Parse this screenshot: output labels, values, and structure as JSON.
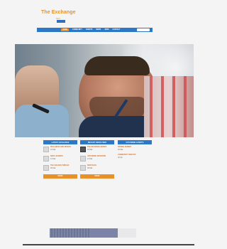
{
  "header": {
    "title": "The Exchange",
    "subtitle": "NPC"
  },
  "nav": {
    "items": [
      "HOME",
      "COMMUNITY",
      "EVENTS",
      "NEWS",
      "JOBS",
      "CONTACT"
    ],
    "active_index": 0
  },
  "columns": {
    "latest_exchange": {
      "header": "LATEST EXCHANGE",
      "items": [
        {
          "title": "WELLNESS AND DESIGN",
          "date": "19 Mar"
        },
        {
          "title": "NEW LEADERS",
          "date": "13 Mar"
        },
        {
          "title": "THE GOLDEN THREAD",
          "date": "06 Mar"
        }
      ],
      "button": "MORE"
    },
    "recent_news": {
      "header": "RECENT NEWS FEED",
      "items": [
        {
          "title": "THE NETWORK SERIES",
          "date": "18 Mar"
        },
        {
          "title": "UPCOMING SESSIONS",
          "date": "12 Mar"
        },
        {
          "title": "NEW BLOG",
          "date": "08 Mar"
        }
      ],
      "button": "MORE"
    },
    "upcoming_events": {
      "header": "UPCOMING EVENTS",
      "items": [
        {
          "title": "SPRING SUMMIT",
          "date": "26 Mar"
        },
        {
          "title": "COMMUNITY MEETUP",
          "date": "02 Apr"
        }
      ]
    }
  }
}
